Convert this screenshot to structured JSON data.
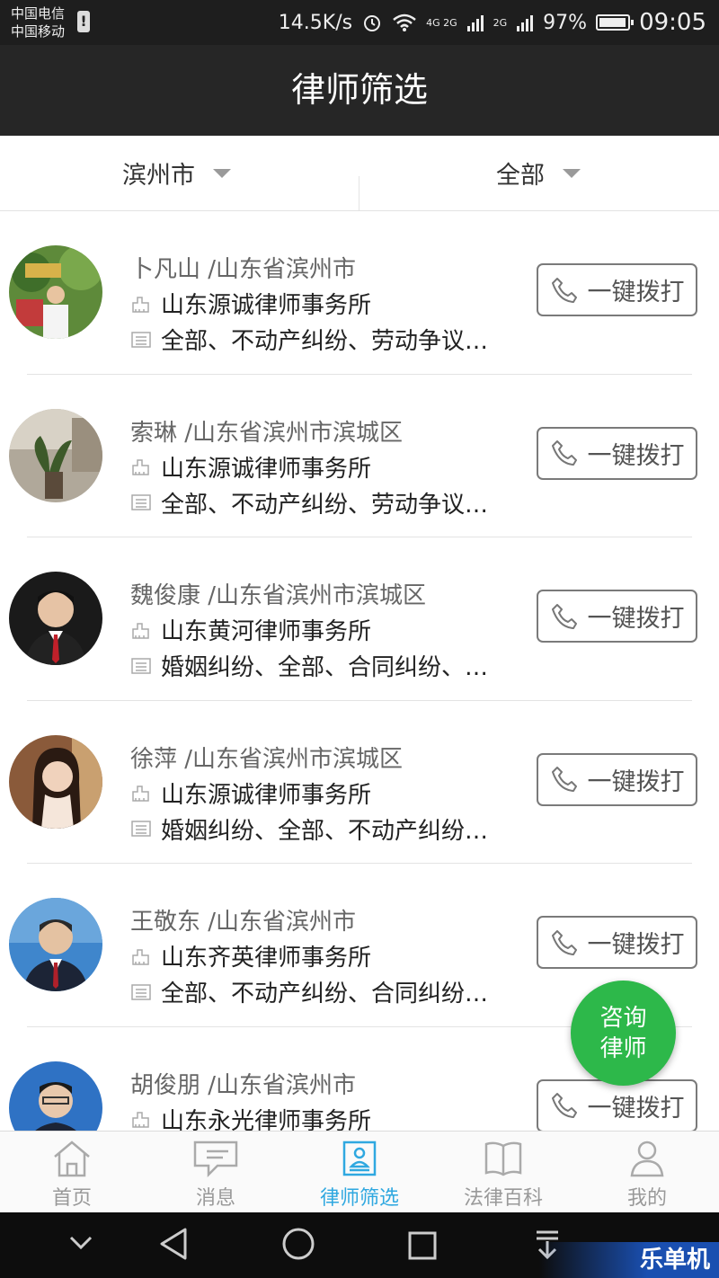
{
  "status_bar": {
    "carrier1": "中国电信",
    "carrier2": "中国移动",
    "speed": "14.5K/s",
    "net1": "4G 2G",
    "net2": "2G",
    "battery": "97%",
    "battery_level": 0.97,
    "time": "09:05"
  },
  "header": {
    "title": "律师筛选"
  },
  "filters": {
    "city": "滨州市",
    "category": "全部"
  },
  "lawyers": [
    {
      "name": "卜凡山 /山东省滨州市",
      "firm": "山东源诚律师事务所",
      "areas": "全部、不动产纠纷、劳动争议…",
      "call_label": "一键拨打"
    },
    {
      "name": "索琳 /山东省滨州市滨城区",
      "firm": "山东源诚律师事务所",
      "areas": "全部、不动产纠纷、劳动争议…",
      "call_label": "一键拨打"
    },
    {
      "name": "魏俊康 /山东省滨州市滨城区",
      "firm": "山东黄河律师事务所",
      "areas": "婚姻纠纷、全部、合同纠纷、…",
      "call_label": "一键拨打"
    },
    {
      "name": "徐萍 /山东省滨州市滨城区",
      "firm": "山东源诚律师事务所",
      "areas": "婚姻纠纷、全部、不动产纠纷…",
      "call_label": "一键拨打"
    },
    {
      "name": "王敬东 /山东省滨州市",
      "firm": "山东齐英律师事务所",
      "areas": "全部、不动产纠纷、合同纠纷…",
      "call_label": "一键拨打"
    },
    {
      "name": "胡俊朋 /山东省滨州市",
      "firm": "山东永光律师事务所",
      "areas": "",
      "call_label": "一键拨打"
    }
  ],
  "fab": {
    "line1": "咨询",
    "line2": "律师"
  },
  "tabs": [
    {
      "label": "首页",
      "icon": "home-icon"
    },
    {
      "label": "消息",
      "icon": "message-icon"
    },
    {
      "label": "律师筛选",
      "icon": "lawyer-filter-icon",
      "active": true
    },
    {
      "label": "法律百科",
      "icon": "book-icon"
    },
    {
      "label": "我的",
      "icon": "profile-icon"
    }
  ],
  "watermark": "乐单机",
  "colors": {
    "accent": "#2fa8e0",
    "fab": "#2db84a",
    "header_bg": "#262626"
  }
}
